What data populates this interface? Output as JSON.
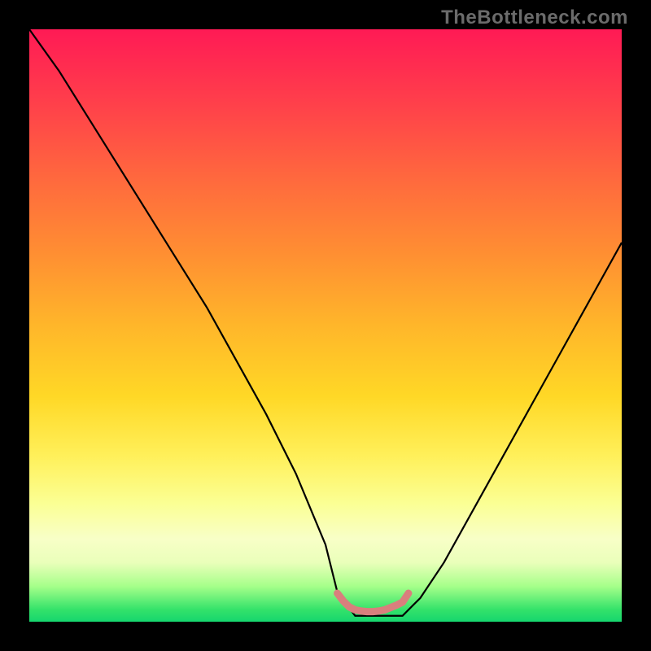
{
  "watermark": "TheBottleneck.com",
  "chart_data": {
    "type": "line",
    "title": "",
    "xlabel": "",
    "ylabel": "",
    "xlim": [
      0,
      100
    ],
    "ylim": [
      0,
      100
    ],
    "grid": false,
    "series": [
      {
        "name": "main-curve",
        "color": "#000000",
        "x": [
          0,
          5,
          10,
          15,
          20,
          25,
          30,
          35,
          40,
          45,
          50,
          52,
          55,
          58,
          60,
          63,
          66,
          70,
          75,
          80,
          85,
          90,
          95,
          100
        ],
        "y": [
          100,
          93,
          85,
          77,
          69,
          61,
          53,
          44,
          35,
          25,
          13,
          5,
          1,
          1,
          1,
          1,
          4,
          10,
          19,
          28,
          37,
          46,
          55,
          64
        ]
      },
      {
        "name": "bottom-marker",
        "color": "#e07a78",
        "x": [
          52,
          53,
          54,
          55,
          56,
          57,
          58,
          59,
          60,
          61,
          62,
          63,
          64
        ],
        "y": [
          4.8,
          3.5,
          2.5,
          2.0,
          1.8,
          1.7,
          1.7,
          1.8,
          2.0,
          2.4,
          2.8,
          3.3,
          4.8
        ]
      }
    ],
    "annotations": []
  }
}
